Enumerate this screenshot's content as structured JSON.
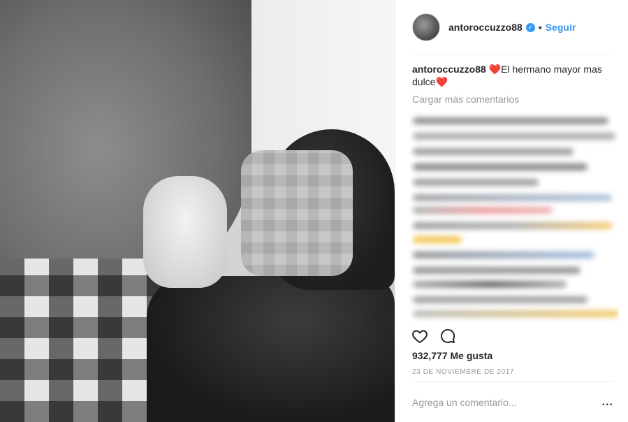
{
  "post": {
    "image_alt": ""
  },
  "header": {
    "username": "antoroccuzzo88",
    "verified_icon": "verified-badge-icon",
    "dot": "•",
    "follow_label": "Seguir"
  },
  "caption": {
    "username": "antoroccuzzo88",
    "text_before_line": "El hermano mayor mas",
    "text_line2": "dulce",
    "emoji": "❤️"
  },
  "comments": {
    "load_more_label": "Cargar más comentarios"
  },
  "actions": {
    "like_icon": "heart-outline-icon",
    "comment_icon": "comment-bubble-icon"
  },
  "stats": {
    "likes_text": "932,777 Me gusta",
    "date_text": "23 DE NOVIEMBRE DE 2017"
  },
  "composer": {
    "placeholder": "Agrega un comentario...",
    "more_label": "..."
  },
  "colors": {
    "accent": "#3897f0",
    "text": "#262626",
    "muted": "#999999",
    "heart": "#ed1c24"
  }
}
